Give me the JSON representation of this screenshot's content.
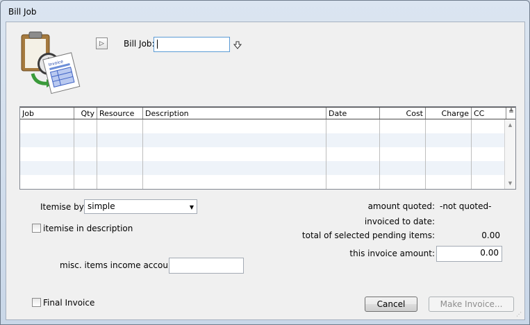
{
  "window": {
    "title": "Bill Job"
  },
  "header": {
    "bill_job_label": "Bill Job:",
    "bill_job_value": ""
  },
  "grid": {
    "columns": [
      "Job",
      "Qty",
      "Resource",
      "Description",
      "Date",
      "Cost",
      "Charge",
      "CC"
    ],
    "rows": []
  },
  "options": {
    "itemise_by_label": "Itemise by:",
    "itemise_by_value": "simple",
    "itemise_in_description_label": "itemise in description",
    "misc_account_label": "misc. items income account:",
    "misc_account_value": "",
    "final_invoice_label": "Final Invoice"
  },
  "summary": {
    "amount_quoted_label": "amount quoted:",
    "amount_quoted_value": "-not quoted-",
    "invoiced_to_date_label": "invoiced to date:",
    "invoiced_to_date_value": "",
    "pending_label": "total of selected pending items:",
    "pending_value": "0.00",
    "invoice_amount_label": "this invoice amount:",
    "invoice_amount_value": "0.00"
  },
  "buttons": {
    "cancel": "Cancel",
    "make_invoice": "Make Invoice..."
  },
  "icons": {
    "app": "clipboard-invoice-icon",
    "expand": "expand-arrow-icon",
    "pick": "pick-arrow-icon"
  }
}
